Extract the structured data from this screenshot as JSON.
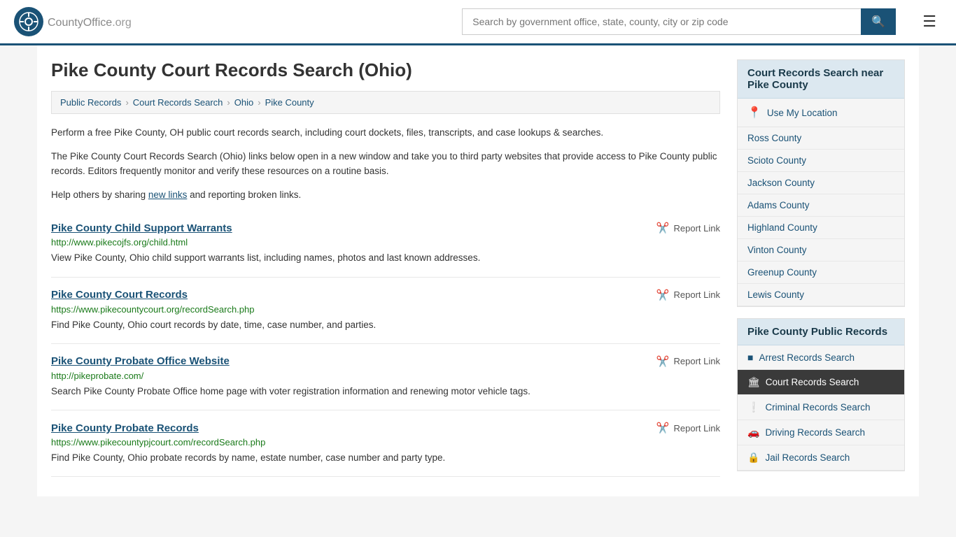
{
  "header": {
    "logo_text": "CountyOffice",
    "logo_ext": ".org",
    "search_placeholder": "Search by government office, state, county, city or zip code"
  },
  "page": {
    "title": "Pike County Court Records Search (Ohio)"
  },
  "breadcrumb": {
    "items": [
      {
        "label": "Public Records",
        "href": "#"
      },
      {
        "label": "Court Records Search",
        "href": "#"
      },
      {
        "label": "Ohio",
        "href": "#"
      },
      {
        "label": "Pike County",
        "href": "#"
      }
    ]
  },
  "description": {
    "para1": "Perform a free Pike County, OH public court records search, including court dockets, files, transcripts, and case lookups & searches.",
    "para2": "The Pike County Court Records Search (Ohio) links below open in a new window and take you to third party websites that provide access to Pike County public records. Editors frequently monitor and verify these resources on a routine basis.",
    "para3_pre": "Help others by sharing ",
    "para3_link": "new links",
    "para3_post": " and reporting broken links."
  },
  "results": [
    {
      "title": "Pike County Child Support Warrants",
      "url": "http://www.pikecojfs.org/child.html",
      "url_color": "green",
      "description": "View Pike County, Ohio child support warrants list, including names, photos and last known addresses.",
      "report_label": "Report Link"
    },
    {
      "title": "Pike County Court Records",
      "url": "https://www.pikecountycourt.org/recordSearch.php",
      "url_color": "green",
      "description": "Find Pike County, Ohio court records by date, time, case number, and parties.",
      "report_label": "Report Link"
    },
    {
      "title": "Pike County Probate Office Website",
      "url": "http://pikeprobate.com/",
      "url_color": "green",
      "description": "Search Pike County Probate Office home page with voter registration information and renewing motor vehicle tags.",
      "report_label": "Report Link"
    },
    {
      "title": "Pike County Probate Records",
      "url": "https://www.pikecountypjcourt.com/recordSearch.php",
      "url_color": "green",
      "description": "Find Pike County, Ohio probate records by name, estate number, case number and party type.",
      "report_label": "Report Link"
    }
  ],
  "sidebar": {
    "nearby_header": "Court Records Search near Pike County",
    "use_location": "Use My Location",
    "counties": [
      {
        "name": "Ross County",
        "href": "#"
      },
      {
        "name": "Scioto County",
        "href": "#"
      },
      {
        "name": "Jackson County",
        "href": "#"
      },
      {
        "name": "Adams County",
        "href": "#"
      },
      {
        "name": "Highland County",
        "href": "#"
      },
      {
        "name": "Vinton County",
        "href": "#"
      },
      {
        "name": "Greenup County",
        "href": "#"
      },
      {
        "name": "Lewis County",
        "href": "#"
      }
    ],
    "public_records_header": "Pike County Public Records",
    "public_records_items": [
      {
        "label": "Arrest Records Search",
        "icon": "■",
        "active": false
      },
      {
        "label": "Court Records Search",
        "icon": "🏛",
        "active": true
      },
      {
        "label": "Criminal Records Search",
        "icon": "!",
        "active": false
      },
      {
        "label": "Driving Records Search",
        "icon": "🚗",
        "active": false
      },
      {
        "label": "Jail Records Search",
        "icon": "🔒",
        "active": false
      }
    ]
  }
}
